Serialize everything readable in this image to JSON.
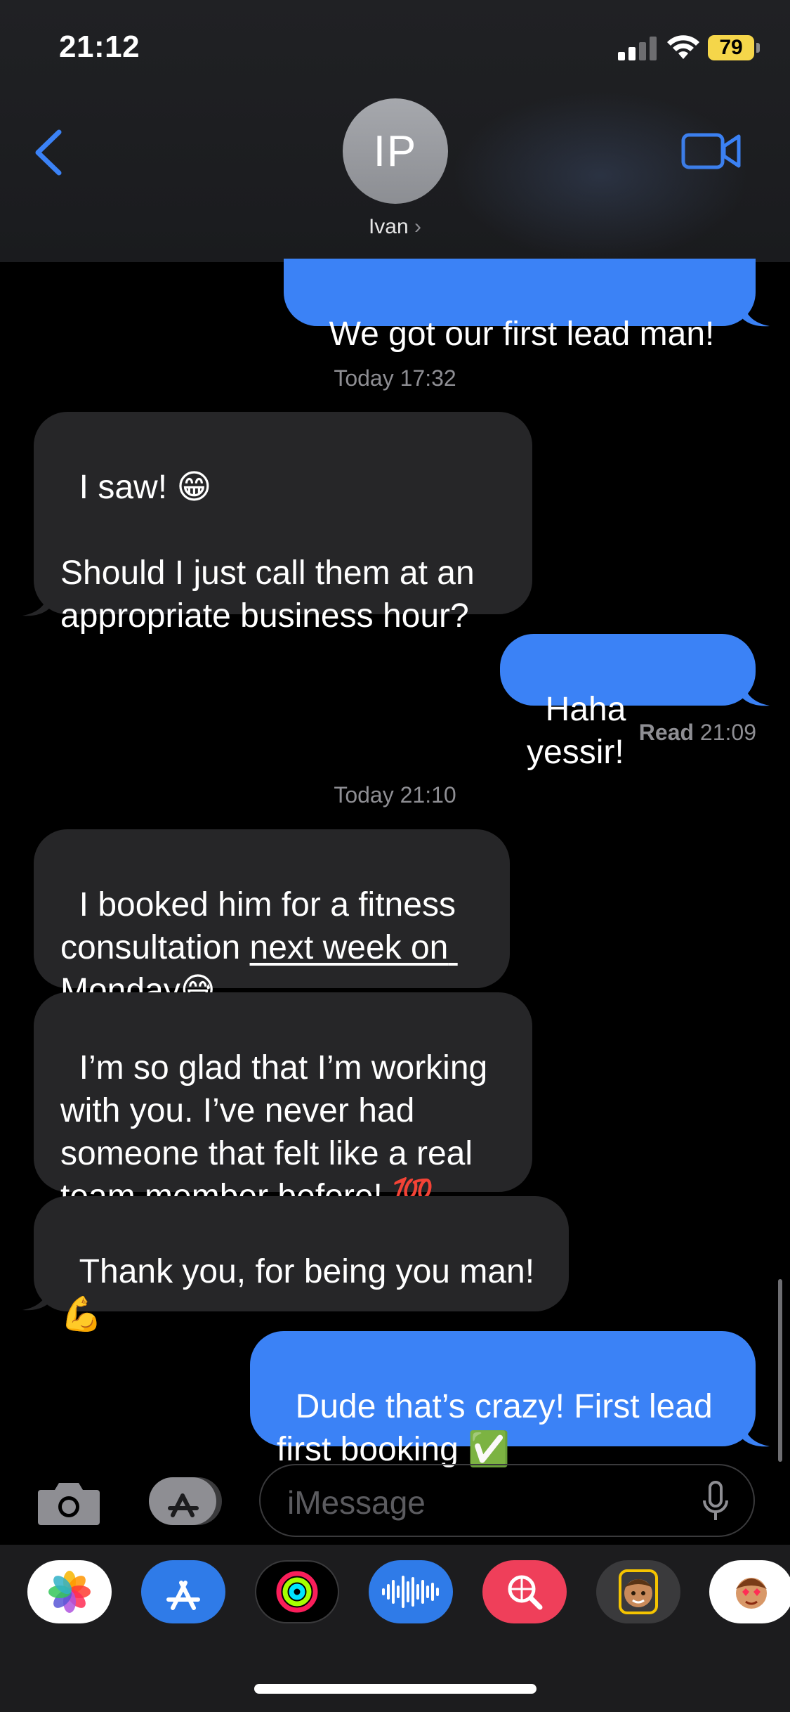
{
  "status_bar": {
    "time": "21:12",
    "battery": "79"
  },
  "header": {
    "avatar_initials": "IP",
    "contact_name": "Ivan",
    "chevron": "›"
  },
  "messages": {
    "m1": "We got our first lead man!",
    "ts1": "Today 17:32",
    "m2": "I saw! 😁\n\nShould I just call them at an appropriate business hour?",
    "m3": "Haha yessir!",
    "read_label": "Read",
    "read_time": " 21:09",
    "ts2": "Today 21:10",
    "m4_pre": "I booked him for a fitness consultation ",
    "m4_link": "next week on Monday",
    "m4_post": "😅",
    "m5": "I’m so glad that I’m working with you. I’ve never had someone that felt like a real team member before! 💯",
    "m6": "Thank you, for being you man!\n💪",
    "m7": "Dude that’s crazy! First lead first booking ✅"
  },
  "input": {
    "placeholder": "iMessage"
  },
  "drawer_apps": [
    "photos-app",
    "app-store-app",
    "activity-app",
    "voice-memo-app",
    "images-search-app",
    "memoji-app",
    "animoji-app"
  ],
  "colors": {
    "outgoing": "#3b82f6",
    "incoming": "#262628",
    "accent": "#3b82f6",
    "battery": "#f5d64a"
  }
}
